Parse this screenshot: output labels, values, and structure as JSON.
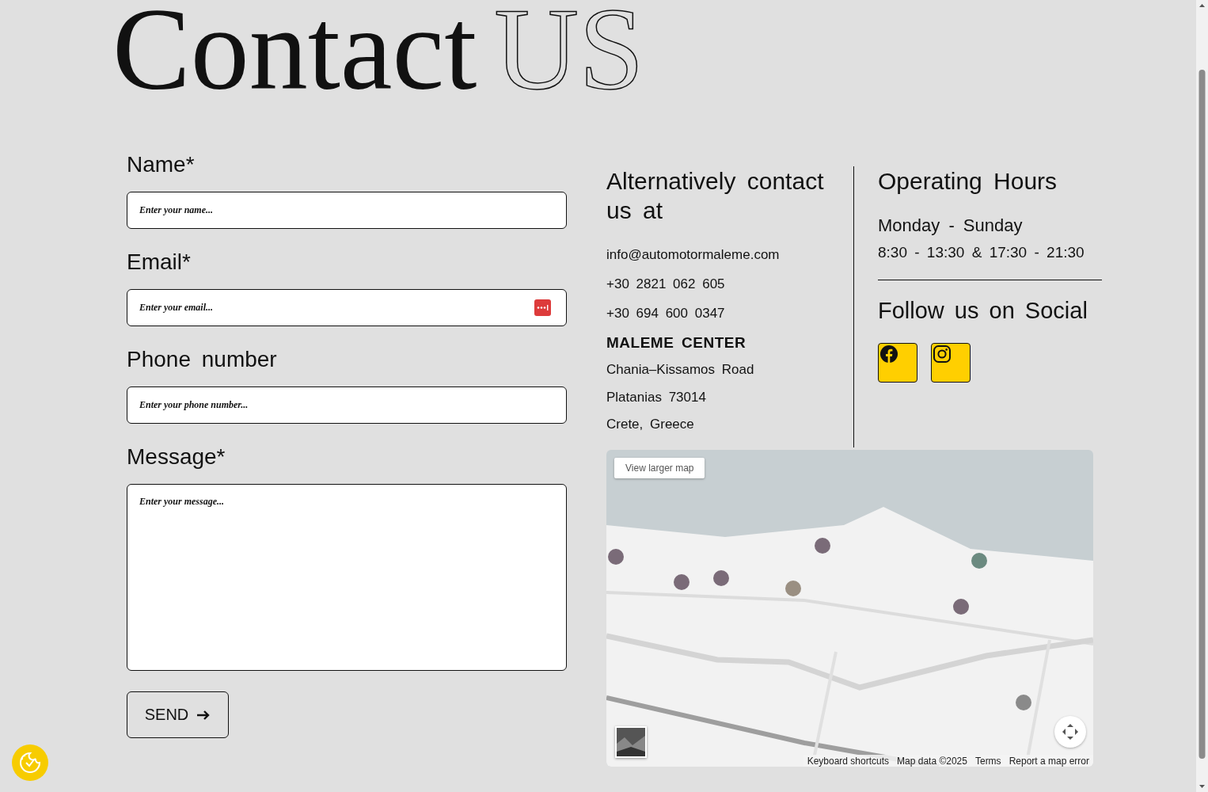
{
  "title": {
    "main": "Contact",
    "outlined": "US"
  },
  "form": {
    "fields": [
      {
        "label": "Name*",
        "placeholder": "Enter your name...",
        "kind": "text"
      },
      {
        "label": "Email*",
        "placeholder": "Enter your email...",
        "kind": "email"
      },
      {
        "label": "Phone number",
        "placeholder": "Enter your phone number...",
        "kind": "text"
      },
      {
        "label": "Message*",
        "placeholder": "Enter your message...",
        "kind": "textarea"
      }
    ],
    "submit": "SEND"
  },
  "contact": {
    "heading": "Alternatively contact us at",
    "email": "info@automotormaleme.com",
    "phones": [
      "+30 2821 062 605",
      "+30 694 600 0347"
    ],
    "location": "MALEME CENTER",
    "address": [
      "Chania–Kissamos Road",
      "Platanias 73014",
      "Crete, Greece"
    ]
  },
  "hours": {
    "heading": "Operating Hours",
    "days": "Monday - Sunday",
    "times": "8:30 - 13:30 & 17:30 - 21:30"
  },
  "social": {
    "heading": "Follow us on Social",
    "links": [
      {
        "kind": "facebook"
      },
      {
        "kind": "instagram"
      }
    ]
  },
  "map": {
    "kind": "picture",
    "button": "View larger map",
    "footer_links": [
      "Keyboard shortcuts",
      "Map data ©2025",
      "Terms",
      "Report a map error"
    ]
  }
}
